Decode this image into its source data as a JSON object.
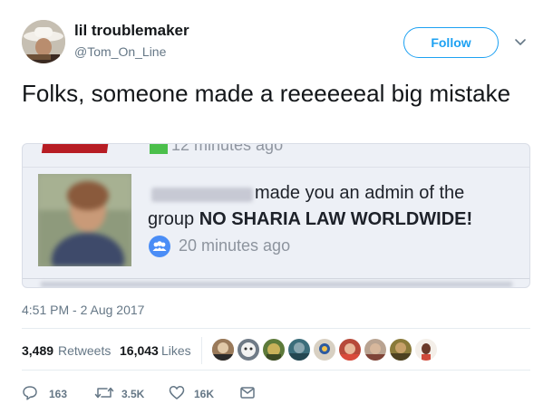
{
  "user": {
    "display_name": "lil troublemaker",
    "handle": "@Tom_On_Line",
    "follow_label": "Follow"
  },
  "tweet": {
    "text": "Folks, someone made a reeeeeeal big mistake",
    "timestamp": "4:51 PM - 2 Aug 2017"
  },
  "embedded": {
    "prev_time": "12 minutes ago",
    "line1": "made you an admin of the",
    "line2_prefix": "group ",
    "group_name": "NO SHARIA LAW WORLDWIDE!",
    "time": "20 minutes ago"
  },
  "stats": {
    "retweets_count": "3,489",
    "retweets_label": "Retweets",
    "likes_count": "16,043",
    "likes_label": "Likes"
  },
  "actions": {
    "replies": "163",
    "retweets": "3.5K",
    "likes": "16K"
  },
  "colors": {
    "accent": "#1da1f2",
    "secondary_text": "#657786",
    "facebook_blue": "#4a8df6"
  },
  "icons": [
    "chevron-down-icon",
    "group-icon",
    "reply-icon",
    "retweet-icon",
    "heart-icon",
    "message-icon"
  ]
}
